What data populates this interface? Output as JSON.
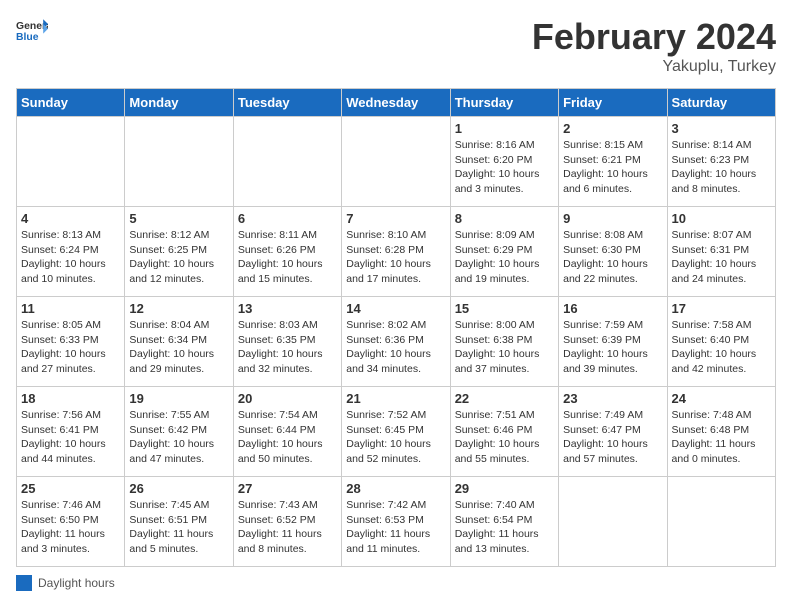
{
  "header": {
    "logo_general": "General",
    "logo_blue": "Blue",
    "title": "February 2024",
    "location": "Yakuplu, Turkey"
  },
  "days_of_week": [
    "Sunday",
    "Monday",
    "Tuesday",
    "Wednesday",
    "Thursday",
    "Friday",
    "Saturday"
  ],
  "legend": {
    "label": "Daylight hours"
  },
  "weeks": [
    [
      {
        "day": "",
        "info": ""
      },
      {
        "day": "",
        "info": ""
      },
      {
        "day": "",
        "info": ""
      },
      {
        "day": "",
        "info": ""
      },
      {
        "day": "1",
        "info": "Sunrise: 8:16 AM\nSunset: 6:20 PM\nDaylight: 10 hours\nand 3 minutes."
      },
      {
        "day": "2",
        "info": "Sunrise: 8:15 AM\nSunset: 6:21 PM\nDaylight: 10 hours\nand 6 minutes."
      },
      {
        "day": "3",
        "info": "Sunrise: 8:14 AM\nSunset: 6:23 PM\nDaylight: 10 hours\nand 8 minutes."
      }
    ],
    [
      {
        "day": "4",
        "info": "Sunrise: 8:13 AM\nSunset: 6:24 PM\nDaylight: 10 hours\nand 10 minutes."
      },
      {
        "day": "5",
        "info": "Sunrise: 8:12 AM\nSunset: 6:25 PM\nDaylight: 10 hours\nand 12 minutes."
      },
      {
        "day": "6",
        "info": "Sunrise: 8:11 AM\nSunset: 6:26 PM\nDaylight: 10 hours\nand 15 minutes."
      },
      {
        "day": "7",
        "info": "Sunrise: 8:10 AM\nSunset: 6:28 PM\nDaylight: 10 hours\nand 17 minutes."
      },
      {
        "day": "8",
        "info": "Sunrise: 8:09 AM\nSunset: 6:29 PM\nDaylight: 10 hours\nand 19 minutes."
      },
      {
        "day": "9",
        "info": "Sunrise: 8:08 AM\nSunset: 6:30 PM\nDaylight: 10 hours\nand 22 minutes."
      },
      {
        "day": "10",
        "info": "Sunrise: 8:07 AM\nSunset: 6:31 PM\nDaylight: 10 hours\nand 24 minutes."
      }
    ],
    [
      {
        "day": "11",
        "info": "Sunrise: 8:05 AM\nSunset: 6:33 PM\nDaylight: 10 hours\nand 27 minutes."
      },
      {
        "day": "12",
        "info": "Sunrise: 8:04 AM\nSunset: 6:34 PM\nDaylight: 10 hours\nand 29 minutes."
      },
      {
        "day": "13",
        "info": "Sunrise: 8:03 AM\nSunset: 6:35 PM\nDaylight: 10 hours\nand 32 minutes."
      },
      {
        "day": "14",
        "info": "Sunrise: 8:02 AM\nSunset: 6:36 PM\nDaylight: 10 hours\nand 34 minutes."
      },
      {
        "day": "15",
        "info": "Sunrise: 8:00 AM\nSunset: 6:38 PM\nDaylight: 10 hours\nand 37 minutes."
      },
      {
        "day": "16",
        "info": "Sunrise: 7:59 AM\nSunset: 6:39 PM\nDaylight: 10 hours\nand 39 minutes."
      },
      {
        "day": "17",
        "info": "Sunrise: 7:58 AM\nSunset: 6:40 PM\nDaylight: 10 hours\nand 42 minutes."
      }
    ],
    [
      {
        "day": "18",
        "info": "Sunrise: 7:56 AM\nSunset: 6:41 PM\nDaylight: 10 hours\nand 44 minutes."
      },
      {
        "day": "19",
        "info": "Sunrise: 7:55 AM\nSunset: 6:42 PM\nDaylight: 10 hours\nand 47 minutes."
      },
      {
        "day": "20",
        "info": "Sunrise: 7:54 AM\nSunset: 6:44 PM\nDaylight: 10 hours\nand 50 minutes."
      },
      {
        "day": "21",
        "info": "Sunrise: 7:52 AM\nSunset: 6:45 PM\nDaylight: 10 hours\nand 52 minutes."
      },
      {
        "day": "22",
        "info": "Sunrise: 7:51 AM\nSunset: 6:46 PM\nDaylight: 10 hours\nand 55 minutes."
      },
      {
        "day": "23",
        "info": "Sunrise: 7:49 AM\nSunset: 6:47 PM\nDaylight: 10 hours\nand 57 minutes."
      },
      {
        "day": "24",
        "info": "Sunrise: 7:48 AM\nSunset: 6:48 PM\nDaylight: 11 hours\nand 0 minutes."
      }
    ],
    [
      {
        "day": "25",
        "info": "Sunrise: 7:46 AM\nSunset: 6:50 PM\nDaylight: 11 hours\nand 3 minutes."
      },
      {
        "day": "26",
        "info": "Sunrise: 7:45 AM\nSunset: 6:51 PM\nDaylight: 11 hours\nand 5 minutes."
      },
      {
        "day": "27",
        "info": "Sunrise: 7:43 AM\nSunset: 6:52 PM\nDaylight: 11 hours\nand 8 minutes."
      },
      {
        "day": "28",
        "info": "Sunrise: 7:42 AM\nSunset: 6:53 PM\nDaylight: 11 hours\nand 11 minutes."
      },
      {
        "day": "29",
        "info": "Sunrise: 7:40 AM\nSunset: 6:54 PM\nDaylight: 11 hours\nand 13 minutes."
      },
      {
        "day": "",
        "info": ""
      },
      {
        "day": "",
        "info": ""
      }
    ]
  ]
}
